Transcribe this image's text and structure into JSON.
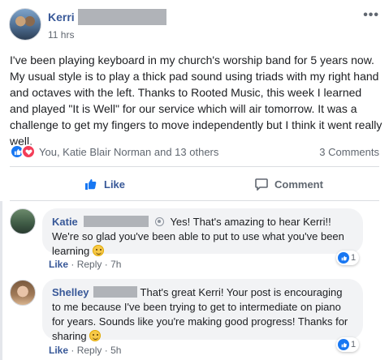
{
  "post": {
    "author": "Kerri",
    "time": "11 hrs",
    "more_icon": "more-horizontal-icon",
    "text": "I've been playing keyboard in my church's worship band for 5 years now. My usual style is to play a thick pad sound using triads with my right hand and octaves with the left. Thanks to Rooted Music, this week I learned and played \"It is Well\" for our service which will air tomorrow. It was a challenge to get my fingers to move independently but I think it went really well.",
    "reactions_text": "You, Katie Blair Norman and 13 others",
    "comments_count": "3 Comments",
    "reaction_icons": [
      "like-icon",
      "love-icon"
    ]
  },
  "actions": {
    "like_label": "Like",
    "comment_label": "Comment"
  },
  "comments": [
    {
      "name": "Katie",
      "text": "Yes! That's amazing to hear Kerri!! We're so glad you've been able to put to use what you've been learning",
      "like_label": "Like",
      "reply_label": "Reply",
      "time": "7h",
      "like_count": "1",
      "emoji": "slightly-smiling-emoji"
    },
    {
      "name": "Shelley",
      "text": "That's great Kerri! Your post is encouraging to me because I've been trying to get to intermediate on piano for years. Sounds like you're making good progress! Thanks for sharing",
      "like_label": "Like",
      "reply_label": "Reply",
      "time": "5h",
      "like_count": "1",
      "emoji": "smiling-emoji"
    }
  ],
  "colors": {
    "link_blue": "#385898",
    "like_blue": "#1877f2",
    "love_red": "#f33e58",
    "bubble_bg": "#f2f3f5",
    "muted_text": "#606770"
  },
  "separator": "·"
}
